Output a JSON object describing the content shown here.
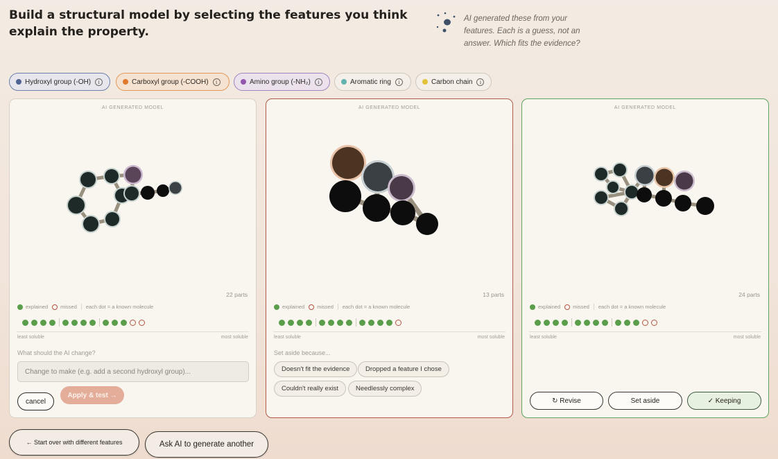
{
  "header": {
    "title": "Build a structural model by selecting the features you think explain the property.",
    "ai_note": "AI generated these from your features. Each is a guess, not an answer. Which fits the evidence?"
  },
  "features": [
    {
      "label": "Hydroxyl group (-OH)",
      "color": "#4f6394",
      "selected": true
    },
    {
      "label": "Carboxyl group (-COOH)",
      "color": "#e0782d",
      "selected": true
    },
    {
      "label": "Amino group (-NH₂)",
      "color": "#9357b0",
      "selected": true
    },
    {
      "label": "Aromatic ring",
      "color": "#62b3b0",
      "selected": false
    },
    {
      "label": "Carbon chain",
      "color": "#e3c33a",
      "selected": false
    }
  ],
  "info_glyph": "i",
  "cards": [
    {
      "label": "AI GENERATED MODEL",
      "parts": "22 parts",
      "legend": {
        "explained": "explained",
        "missed": "missed",
        "note": "each dot = a known molecule"
      },
      "evidence": [
        [
          true,
          true,
          true,
          true
        ],
        [
          true,
          true,
          true,
          true
        ],
        [
          true,
          true,
          true,
          false,
          false
        ]
      ],
      "axis_left": "least soluble",
      "axis_right": "most soluble",
      "revise": {
        "question": "What should the AI change?",
        "placeholder": "Change to make (e.g. add a second hydroxyl group)...",
        "cancel": "cancel",
        "apply": "Apply & test →"
      }
    },
    {
      "label": "AI GENERATED MODEL",
      "parts": "13 parts",
      "legend": {
        "explained": "explained",
        "missed": "missed",
        "note": "each dot = a known molecule"
      },
      "evidence": [
        [
          true,
          true,
          true,
          true
        ],
        [
          true,
          true,
          true,
          true
        ],
        [
          true,
          true,
          true,
          true,
          false
        ]
      ],
      "axis_left": "least soluble",
      "axis_right": "most soluble",
      "aside": {
        "question": "Set aside because...",
        "reasons": [
          "Doesn't fit the evidence",
          "Dropped a feature I chose",
          "Couldn't really exist",
          "Needlessly complex"
        ]
      }
    },
    {
      "label": "AI GENERATED MODEL",
      "parts": "24 parts",
      "legend": {
        "explained": "explained",
        "missed": "missed",
        "note": "each dot = a known molecule"
      },
      "evidence": [
        [
          true,
          true,
          true,
          true
        ],
        [
          true,
          true,
          true,
          true
        ],
        [
          true,
          true,
          true,
          false,
          false
        ]
      ],
      "axis_left": "least soluble",
      "axis_right": "most soluble",
      "actions": {
        "revise": "↻ Revise",
        "set_aside": "Set aside",
        "keeping": "✓ Keeping"
      }
    }
  ],
  "footer": {
    "start_over": "← Start over with different features",
    "generate": "Ask AI to generate another"
  },
  "colors": {
    "explained": "#5a9e4c",
    "missed": "#b5543f",
    "card_selected_red": "#b05a49",
    "card_selected_green": "#5fa460",
    "apply_button": "#e4ad9a"
  }
}
